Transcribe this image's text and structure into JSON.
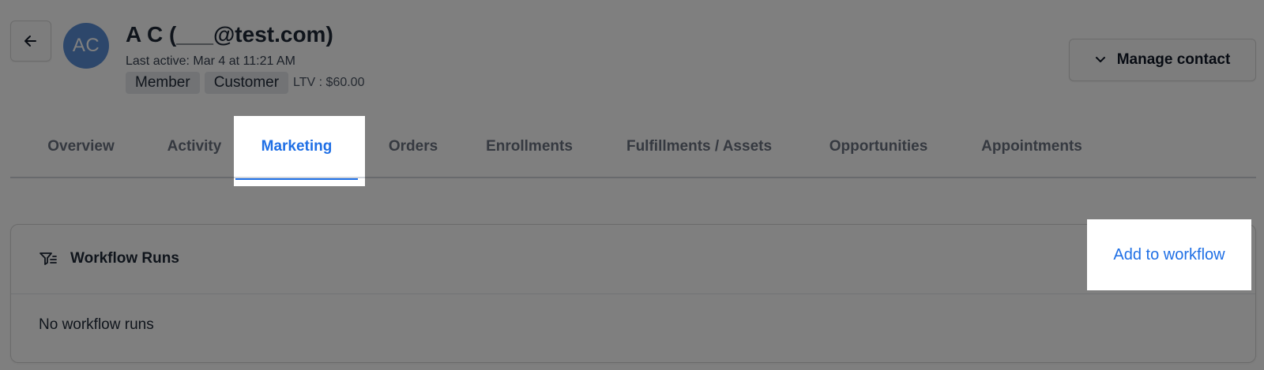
{
  "header": {
    "back_icon": "arrow-left-icon",
    "avatar_initials": "AC",
    "contact_name": "A C (___@test.com)",
    "last_active": "Last active: Mar 4 at 11:21 AM",
    "tags": [
      "Member",
      "Customer"
    ],
    "ltv": "LTV : $60.00",
    "manage_button": {
      "label": "Manage contact",
      "icon": "chevron-down-icon"
    }
  },
  "tabs": [
    {
      "label": "Overview",
      "active": false
    },
    {
      "label": "Activity",
      "active": false
    },
    {
      "label": "Marketing",
      "active": true
    },
    {
      "label": "Orders",
      "active": false
    },
    {
      "label": "Enrollments",
      "active": false
    },
    {
      "label": "Fulfillments / Assets",
      "active": false
    },
    {
      "label": "Opportunities",
      "active": false
    },
    {
      "label": "Appointments",
      "active": false
    }
  ],
  "workflow_card": {
    "icon": "filter-list-icon",
    "title": "Workflow Runs",
    "add_link": "Add to workflow",
    "empty_text": "No workflow runs"
  },
  "colors": {
    "accent": "#1f6fe5",
    "avatar": "#5b8fd6",
    "overlay": "rgba(0,0,0,0.5)"
  }
}
